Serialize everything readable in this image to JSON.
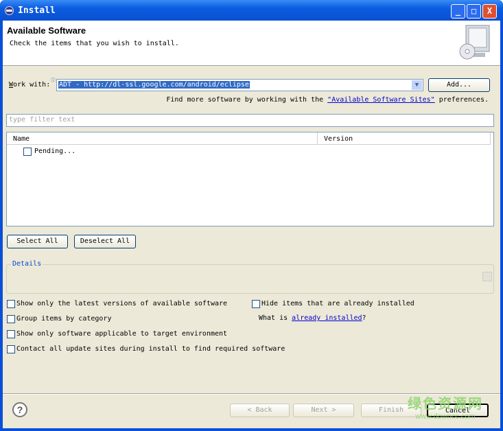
{
  "window": {
    "title": "Install",
    "buttons": {
      "minimize": "_",
      "maximize": "□",
      "close": "X"
    }
  },
  "header": {
    "title": "Available Software",
    "subtitle": "Check the items that you wish to install."
  },
  "work_with": {
    "label_prefix": "W",
    "label_rest": "ork with:",
    "value": "ADT - http://dl-ssl.google.com/android/eclipse",
    "add_button": "Add..."
  },
  "find_more": {
    "before": "Find more software by working with the ",
    "link": "\"Available Software Sites\"",
    "after": " preferences."
  },
  "filter": {
    "placeholder": "type filter text"
  },
  "tree": {
    "columns": [
      "Name",
      "Version"
    ],
    "items": [
      {
        "label": "Pending...",
        "checked": false
      }
    ]
  },
  "select_all": "Select All",
  "deselect_all": "Deselect All",
  "details": {
    "label": "Details"
  },
  "options": [
    {
      "label": "Show only the latest versions of available software",
      "checked": false
    },
    {
      "label": "Group items by category",
      "checked": false
    },
    {
      "label": "Show only software applicable to target environment",
      "checked": false
    },
    {
      "label": "Contact all update sites during install to find required software",
      "checked": false
    },
    {
      "label": "Hide items that are already installed",
      "checked": false
    }
  ],
  "what_is": {
    "before": "What is ",
    "link": "already installed",
    "after": "?"
  },
  "footer": {
    "back": "< Back",
    "next": "Next >",
    "finish": "Finish",
    "cancel": "Cancel"
  },
  "watermark": {
    "cn": "绿色资源网",
    "url": "www.downcc.com"
  }
}
